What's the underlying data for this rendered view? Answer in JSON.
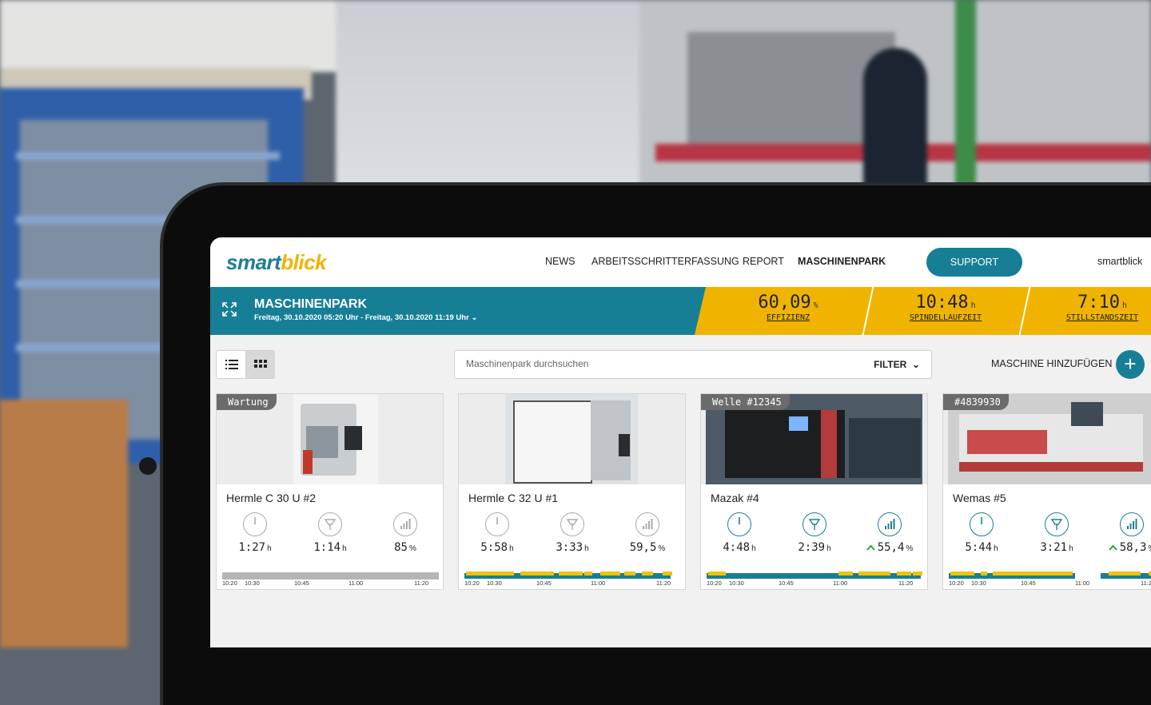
{
  "nav": {
    "logo": "smartblick",
    "items": [
      "NEWS",
      "ARBEITSSCHRITTERFASSUNG",
      "REPORT",
      "MASCHINENPARK"
    ],
    "support": "SUPPORT",
    "user": "smartblick"
  },
  "header": {
    "title": "MASCHINENPARK",
    "date_range": "Freitag, 30.10.2020 05:20 Uhr - Freitag, 30.10.2020 11:19 Uhr"
  },
  "kpis": [
    {
      "value": "60,09",
      "unit": "%",
      "label": "EFFIZIENZ"
    },
    {
      "value": "10:48",
      "unit": "h",
      "label": "SPINDELLAUFZEIT"
    },
    {
      "value": "7:10",
      "unit": "h",
      "label": "STILLSTANDSZEIT"
    }
  ],
  "toolbar": {
    "search_placeholder": "Maschinenpark durchsuchen",
    "filter": "FILTER",
    "add_label": "MASCHINE HINZUFÜGEN",
    "add_icon": "+"
  },
  "timeline_ticks": [
    "10:20",
    "10:30",
    "10:45",
    "11:00",
    "11:20"
  ],
  "cards": [
    {
      "tag": "Wartung",
      "name": "Hermle C 30 U #2",
      "power": "1:27",
      "power_unit": "h",
      "spindle": "1:14",
      "spindle_unit": "h",
      "efficiency": "85",
      "efficiency_unit": "%",
      "trend": "",
      "active": false
    },
    {
      "tag": "",
      "name": "Hermle C 32 U #1",
      "power": "5:58",
      "power_unit": "h",
      "spindle": "3:33",
      "spindle_unit": "h",
      "efficiency": "59,5",
      "efficiency_unit": "%",
      "trend": "",
      "active": false
    },
    {
      "tag": "Welle #12345",
      "name": "Mazak #4",
      "power": "4:48",
      "power_unit": "h",
      "spindle": "2:39",
      "spindle_unit": "h",
      "efficiency": "55,4",
      "efficiency_unit": "%",
      "trend": "^",
      "active": true
    },
    {
      "tag": "#4839930",
      "name": "Wemas #5",
      "power": "5:44",
      "power_unit": "h",
      "spindle": "3:21",
      "spindle_unit": "h",
      "efficiency": "58,3",
      "efficiency_unit": "%",
      "trend": "^",
      "active": true
    }
  ],
  "colors": {
    "teal": "#167f96",
    "yellow": "#f0b400",
    "grey": "#6b6b6b"
  }
}
